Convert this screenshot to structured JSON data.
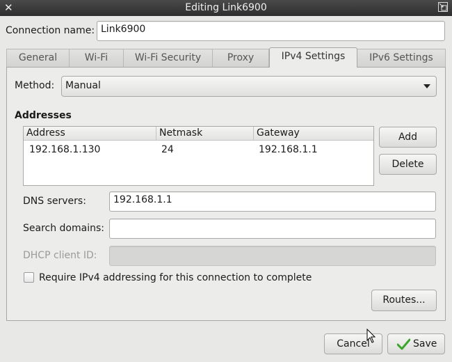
{
  "window": {
    "title": "Editing Link6900",
    "close_glyph": "✕"
  },
  "connection": {
    "name_label": "Connection name:",
    "name_value": "Link6900"
  },
  "tabs": [
    {
      "label": "General"
    },
    {
      "label": "Wi-Fi"
    },
    {
      "label": "Wi-Fi Security"
    },
    {
      "label": "Proxy"
    },
    {
      "label": "IPv4 Settings"
    },
    {
      "label": "IPv6 Settings"
    }
  ],
  "active_tab": "IPv4 Settings",
  "ipv4": {
    "method_label": "Method:",
    "method_value": "Manual",
    "addresses_heading": "Addresses",
    "columns": [
      "Address",
      "Netmask",
      "Gateway"
    ],
    "rows": [
      {
        "address": "192.168.1.130",
        "netmask": "24",
        "gateway": "192.168.1.1"
      }
    ],
    "add_label": "Add",
    "delete_label": "Delete",
    "dns_label": "DNS servers:",
    "dns_value": "192.168.1.1",
    "search_label": "Search domains:",
    "search_value": "",
    "dhcp_label": "DHCP client ID:",
    "dhcp_value": "",
    "require_label": "Require IPv4 addressing for this connection to complete",
    "require_checked": false,
    "routes_label": "Routes..."
  },
  "footer": {
    "cancel_label": "Cancel",
    "save_label": "Save"
  },
  "colors": {
    "titlebar": "#3a3a3a",
    "window_bg": "#e8e8e7",
    "save_check": "#3aa52a"
  }
}
